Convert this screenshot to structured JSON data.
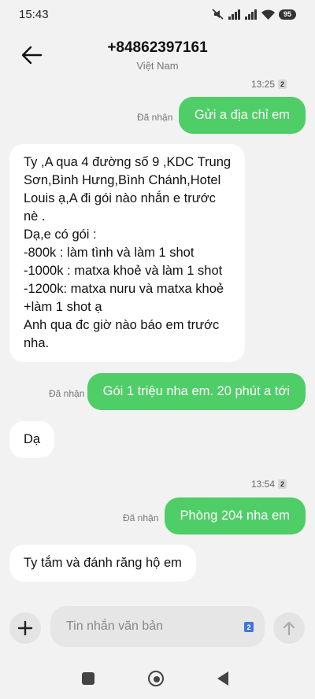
{
  "status_bar": {
    "time": "15:43",
    "battery": "95",
    "icons": [
      "mute-icon",
      "signal-icon",
      "signal-icon",
      "wifi-icon",
      "battery-icon"
    ]
  },
  "header": {
    "title": "+84862397161",
    "subtitle": "Việt Nam"
  },
  "messages": {
    "ts1": {
      "time": "13:25",
      "sim": "2"
    },
    "out1": {
      "status": "Đã nhận",
      "text": "Gửi a địa chỉ em"
    },
    "in1": {
      "lines": [
        "Ty ,A qua 4 đường số 9 ,KDC Trung",
        "Sơn,Bình Hưng,Bình Chánh,Hotel",
        "Louis ạ,A đi gói nào nhắn e trước",
        "nè .",
        "Dạ,e có gói :",
        "-800k :  làm tình và làm 1 shot",
        "-1000k : matxa khoẻ và làm 1 shot",
        "-1200k: matxa nuru và matxa khoẻ",
        "+làm 1 shot  ạ",
        "Anh qua đc giờ nào báo em trước",
        "nha."
      ]
    },
    "out2": {
      "status": "Đã nhận",
      "text": "Gói 1 triệu nha em. 20 phút a tới"
    },
    "in2": {
      "text": "Dạ"
    },
    "ts2": {
      "time": "13:54",
      "sim": "2"
    },
    "out3": {
      "status": "Đã nhận",
      "text": "Phòng 204 nha em"
    },
    "in3": {
      "text": "Ty tắm và đánh răng hộ em"
    }
  },
  "compose": {
    "placeholder": "Tin nhắn văn bản",
    "sim": "2"
  },
  "colors": {
    "outgoing_bubble": "#4fce67",
    "incoming_bubble": "#ffffff",
    "background": "#f2f2f2",
    "sim_chip": "#3f78d8"
  }
}
